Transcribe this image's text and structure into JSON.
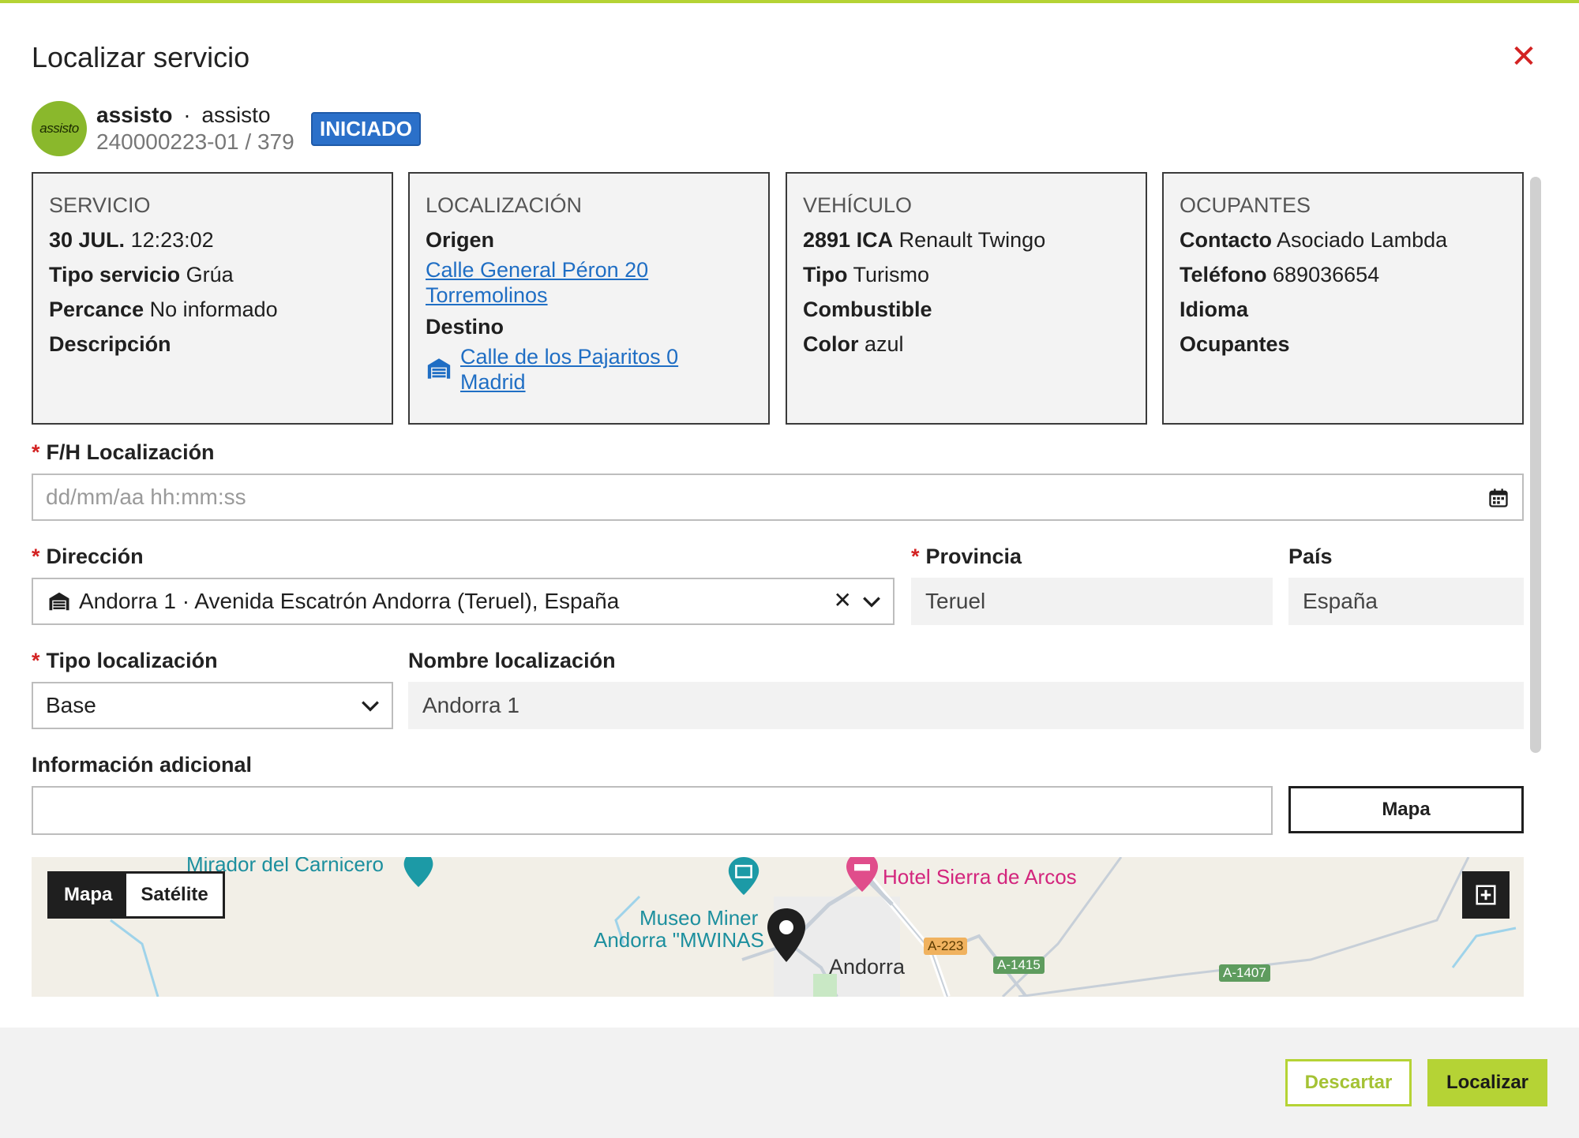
{
  "modal": {
    "title": "Localizar servicio",
    "close_icon": "close-icon"
  },
  "header": {
    "avatar_text": "assisto",
    "client_name": "assisto",
    "separator": "·",
    "client_secondary": "assisto",
    "reference": "240000223-01 / 379",
    "status": "INICIADO"
  },
  "cards": {
    "servicio": {
      "title": "SERVICIO",
      "date": "30 JUL.",
      "time": "12:23:02",
      "tipo_label": "Tipo servicio",
      "tipo_value": "Grúa",
      "percance_label": "Percance",
      "percance_value": "No informado",
      "descripcion_label": "Descripción"
    },
    "localizacion": {
      "title": "LOCALIZACIÓN",
      "origen_label": "Origen",
      "origen_line1": "Calle General Péron 20",
      "origen_line2": "Torremolinos",
      "destino_label": "Destino",
      "destino_line1": "Calle de los Pajaritos 0",
      "destino_line2": "Madrid"
    },
    "vehiculo": {
      "title": "VEHÍCULO",
      "plate": "2891 ICA",
      "model": "Renault Twingo",
      "tipo_label": "Tipo",
      "tipo_value": "Turismo",
      "combustible_label": "Combustible",
      "color_label": "Color",
      "color_value": "azul"
    },
    "ocupantes": {
      "title": "OCUPANTES",
      "contacto_label": "Contacto",
      "contacto_value": "Asociado Lambda",
      "telefono_label": "Teléfono",
      "telefono_value": "689036654",
      "idioma_label": "Idioma",
      "ocupantes_label": "Ocupantes"
    }
  },
  "form": {
    "fh_label": "F/H Localización",
    "fh_placeholder": "dd/mm/aa hh:mm:ss",
    "direccion_label": "Dirección",
    "direccion_value": "Andorra 1 · Avenida Escatrón Andorra (Teruel), España",
    "provincia_label": "Provincia",
    "provincia_value": "Teruel",
    "pais_label": "País",
    "pais_value": "España",
    "tipo_label": "Tipo localización",
    "tipo_value": "Base",
    "nombre_label": "Nombre localización",
    "nombre_value": "Andorra 1",
    "info_label": "Información adicional",
    "info_value": "",
    "mapa_button": "Mapa"
  },
  "map": {
    "toggle_map": "Mapa",
    "toggle_satellite": "Satélite",
    "labels": {
      "mirador": "Mirador del Carnicero",
      "museo_1": "Museo Miner",
      "museo_2": "Andorra \"MWINAS",
      "hotel": "Hotel Sierra de Arcos",
      "town": "Andorra"
    },
    "roads": {
      "a223": "A-223",
      "a1415": "A-1415",
      "a1407": "A-1407"
    }
  },
  "footer": {
    "discard": "Descartar",
    "locate": "Localizar"
  },
  "colors": {
    "accent": "#b5d335",
    "status": "#2b70c9",
    "link": "#1f6ec4",
    "danger": "#d32222"
  }
}
